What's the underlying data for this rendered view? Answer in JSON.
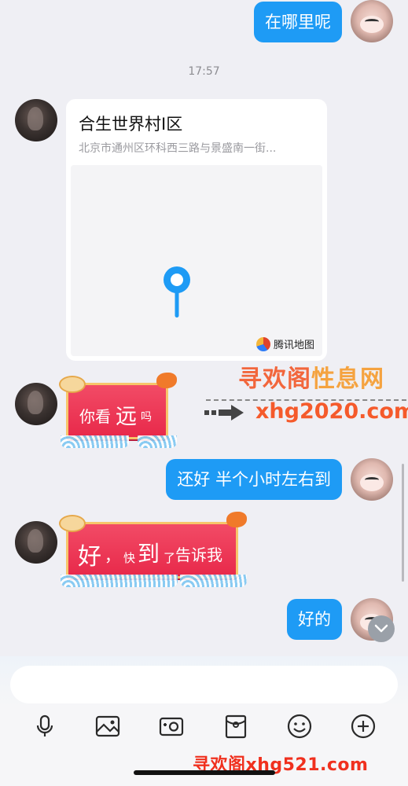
{
  "messages": {
    "m1_text": "在哪里呢",
    "time": "17:57",
    "location": {
      "title": "合生世界村I区",
      "address": "北京市通州区环科西三路与景盛南一街...",
      "map_brand": "腾讯地图"
    },
    "m3": {
      "p1": "你看",
      "p2": "远",
      "p3": "吗"
    },
    "m4_text": "还好 半个小时左右到",
    "m5": {
      "p1": "好",
      "p2": "，",
      "p3": "快",
      "p4": "到",
      "p5": "了",
      "p6": "告诉我"
    },
    "m6_text": "好的"
  },
  "watermarks": {
    "top_cn_a": "寻欢阁",
    "top_cn_b": "性息网",
    "top_url": "xhg2020.com",
    "bottom": "寻欢阁xhg521.com"
  },
  "composer": {
    "placeholder": "",
    "icons": [
      "microphone-icon",
      "photo-icon",
      "camera-icon",
      "red-packet-icon",
      "emoji-icon",
      "plus-icon"
    ]
  },
  "colors": {
    "bubble_me": "#1e9bf5",
    "festive": "#e8294a",
    "background": "#efeff4"
  }
}
